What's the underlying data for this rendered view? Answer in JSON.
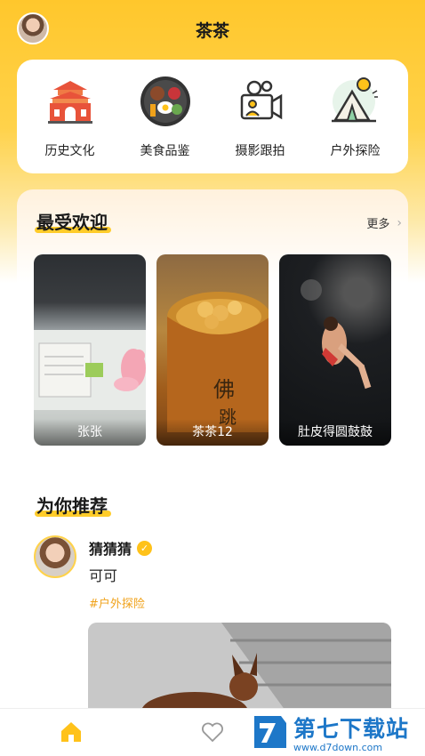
{
  "header": {
    "title": "茶茶"
  },
  "categories": [
    {
      "label": "历史文化",
      "icon": "gate-tower-icon"
    },
    {
      "label": "美食品鉴",
      "icon": "food-plate-icon"
    },
    {
      "label": "摄影跟拍",
      "icon": "video-camera-icon"
    },
    {
      "label": "户外探险",
      "icon": "tent-sun-icon"
    }
  ],
  "popular": {
    "title": "最受欢迎",
    "more": "更多",
    "items": [
      {
        "label": "张张"
      },
      {
        "label": "茶茶12"
      },
      {
        "label": "肚皮得圆鼓鼓"
      }
    ]
  },
  "recommend": {
    "title": "为你推荐",
    "post": {
      "user": "猜猜猜",
      "text": "可可",
      "tag": "#户外探险"
    }
  },
  "tabbar": {
    "items": [
      "home-icon",
      "heart-icon"
    ]
  },
  "watermark": {
    "brand": "第七下载站",
    "url": "www.d7down.com"
  },
  "colors": {
    "accent": "#ffc72c",
    "tag": "#f0a21a"
  }
}
